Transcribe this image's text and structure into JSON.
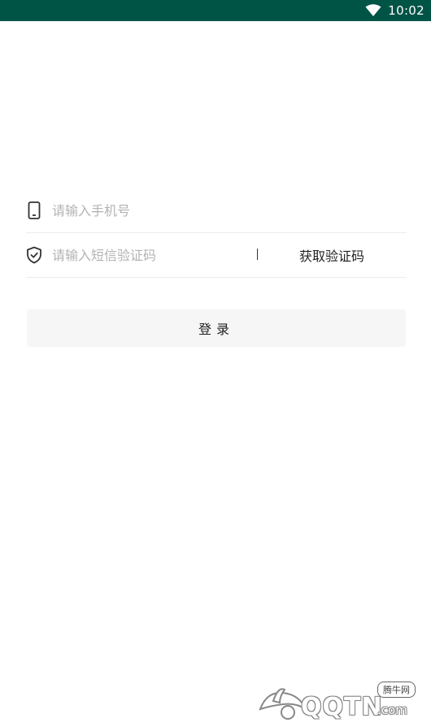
{
  "status_bar": {
    "time": "10:02",
    "wifi_icon": "wifi-icon",
    "background": "#005446"
  },
  "form": {
    "phone": {
      "icon": "mobile-phone-icon",
      "value": "",
      "placeholder": "请输入手机号"
    },
    "code": {
      "icon": "shield-check-icon",
      "value": "",
      "placeholder": "请输入短信验证码",
      "get_code_label": "获取验证码"
    },
    "login_label": "登录"
  },
  "watermark": {
    "text": "QQTN",
    "suffix": ".com",
    "cn_label": "腾牛网"
  }
}
